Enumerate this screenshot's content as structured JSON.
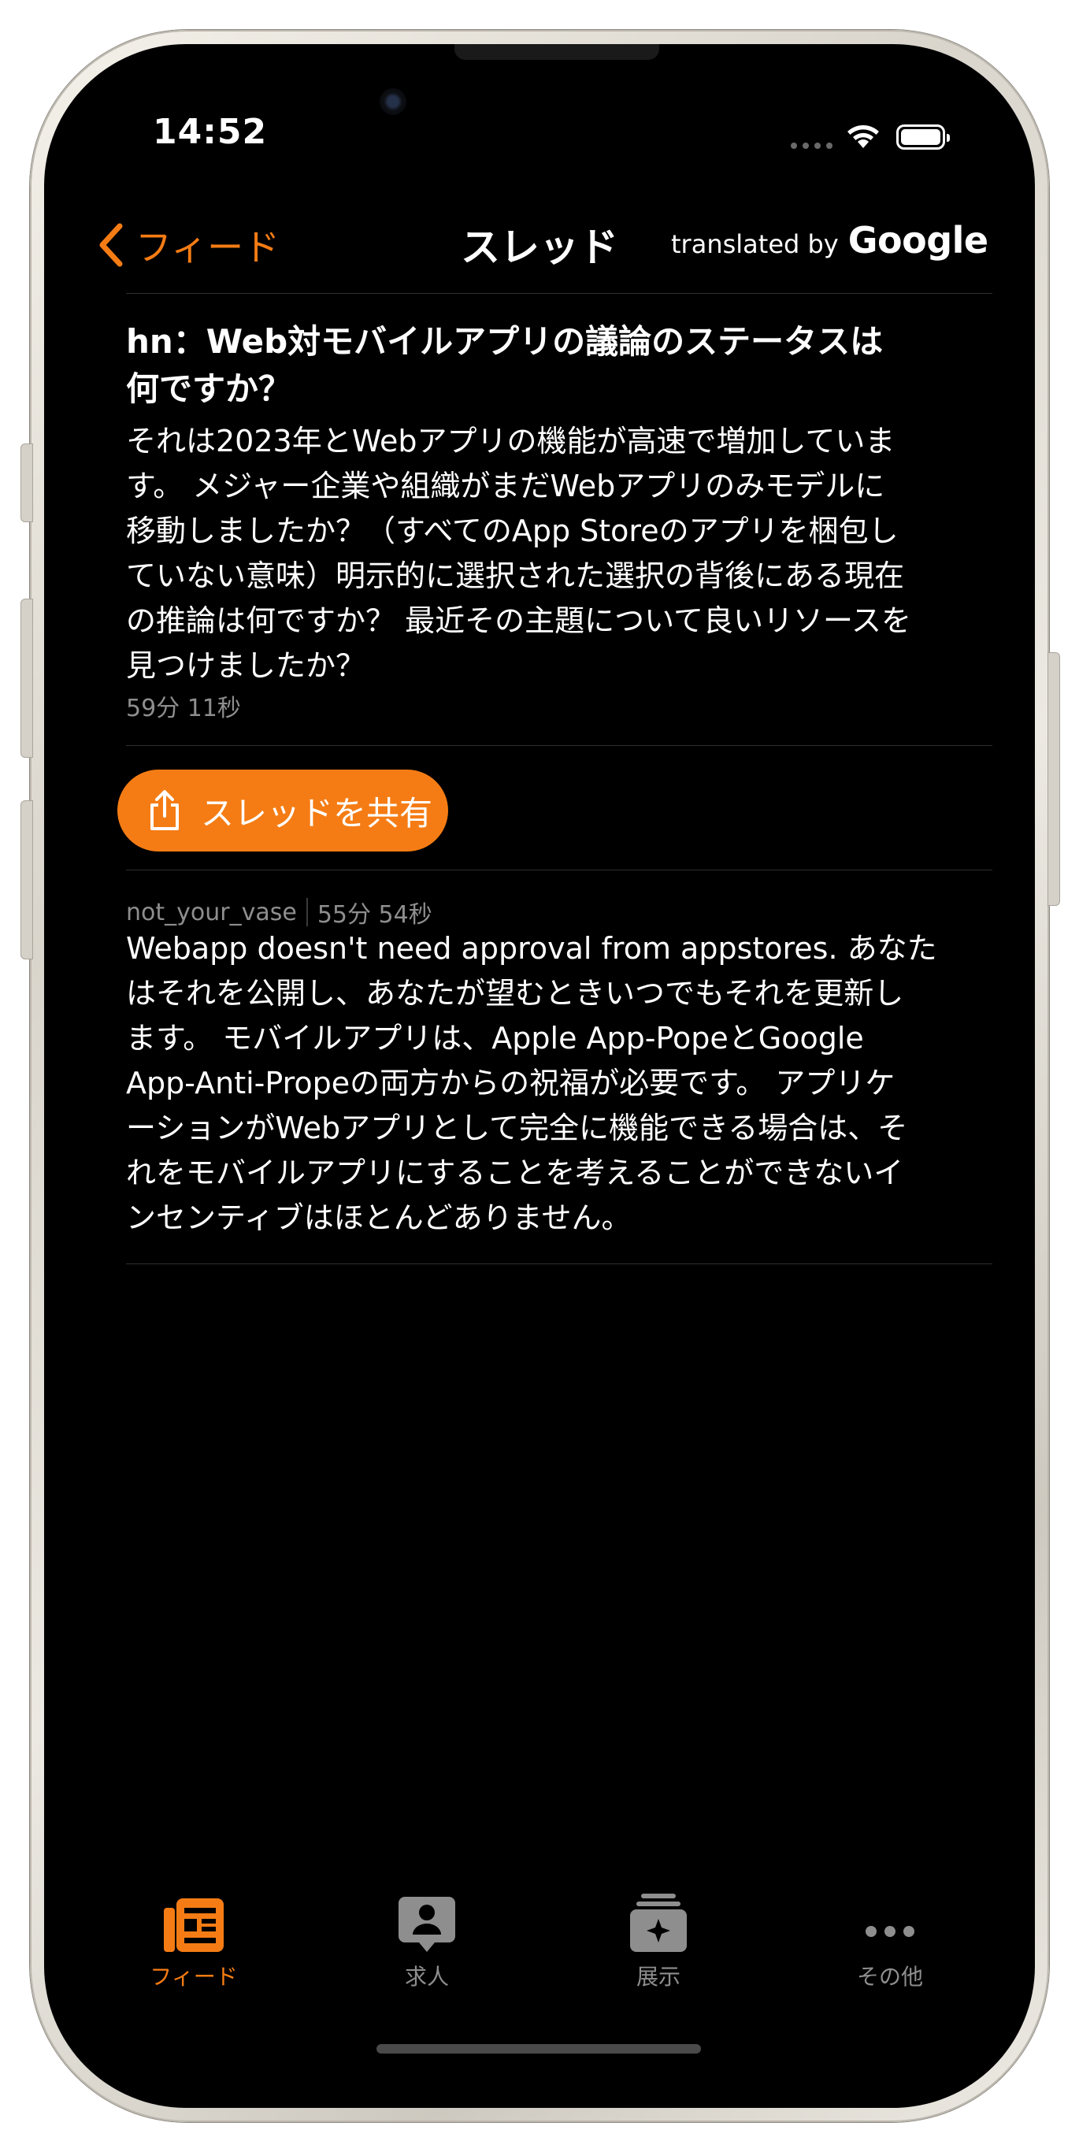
{
  "status_bar": {
    "time": "14:52"
  },
  "nav": {
    "back_label": "フィード",
    "title": "スレッド",
    "translated_by": "translated by",
    "translator_brand": "Google"
  },
  "post": {
    "title_line1": "hn：Web対モバイルアプリの議論のステータスは",
    "title_line2": "何ですか？",
    "body_lines": [
      "それは2023年とWebアプリの機能が高速で増加していま",
      "す。 メジャー企業や組織がまだWebアプリのみモデルに",
      "移動しましたか？（すべてのApp Storeのアプリを梱包し",
      "ていない意味）明示的に選択された選択の背後にある現在",
      "の推論は何ですか？ 最近その主題について良いリソースを",
      "見つけましたか？"
    ],
    "time_ago": "59分 11秒"
  },
  "share_button": {
    "label": "スレッドを共有",
    "icon": "share-icon"
  },
  "comment": {
    "author": "not_your_vase",
    "time_ago": "55分 54秒",
    "body_lines": [
      "Webapp doesn't need approval from appstores. あなた",
      "はそれを公開し、あなたが望むときいつでもそれを更新し",
      "ます。 モバイルアプリは、Apple App-PopeとGoogle",
      "App-Anti-Propeの両方からの祝福が必要です。 アプリケ",
      "ーションがWebアプリとして完全に機能できる場合は、そ",
      "れをモバイルアプリにすることを考えることができないイ",
      "ンセンティブはほとんどありません。"
    ]
  },
  "tabs": [
    {
      "label": "フィード",
      "icon": "feed-icon",
      "active": true
    },
    {
      "label": "求人",
      "icon": "jobs-icon",
      "active": false
    },
    {
      "label": "展示",
      "icon": "showcase-icon",
      "active": false
    },
    {
      "label": "その他",
      "icon": "more-icon",
      "active": false
    }
  ],
  "colors": {
    "accent": "#f57c14",
    "background": "#000000",
    "secondary_text": "#8e8e8e",
    "inactive_tab": "#8e8e8e"
  }
}
